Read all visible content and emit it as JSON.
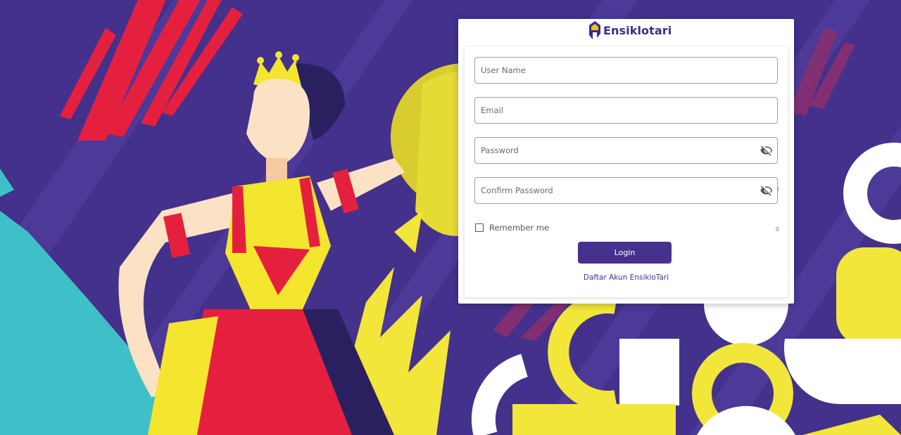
{
  "brand": {
    "name": "Ensiklotari",
    "logo_icon": "ensiklotari-logo-icon",
    "primary_color": "#46318e",
    "background_color": "#43318c"
  },
  "form": {
    "username": {
      "placeholder": "User Name",
      "value": ""
    },
    "email": {
      "placeholder": "Email",
      "value": ""
    },
    "password": {
      "placeholder": "Password",
      "value": "",
      "counter": "0",
      "icon": "eye-off-icon"
    },
    "confirm_password": {
      "placeholder": "Confirm Password",
      "value": "",
      "counter": "0",
      "icon": "eye-off-icon"
    },
    "remember_label": "Remember me",
    "login_label": "Login",
    "register_link": "Daftar Akun EnsikloTari"
  }
}
